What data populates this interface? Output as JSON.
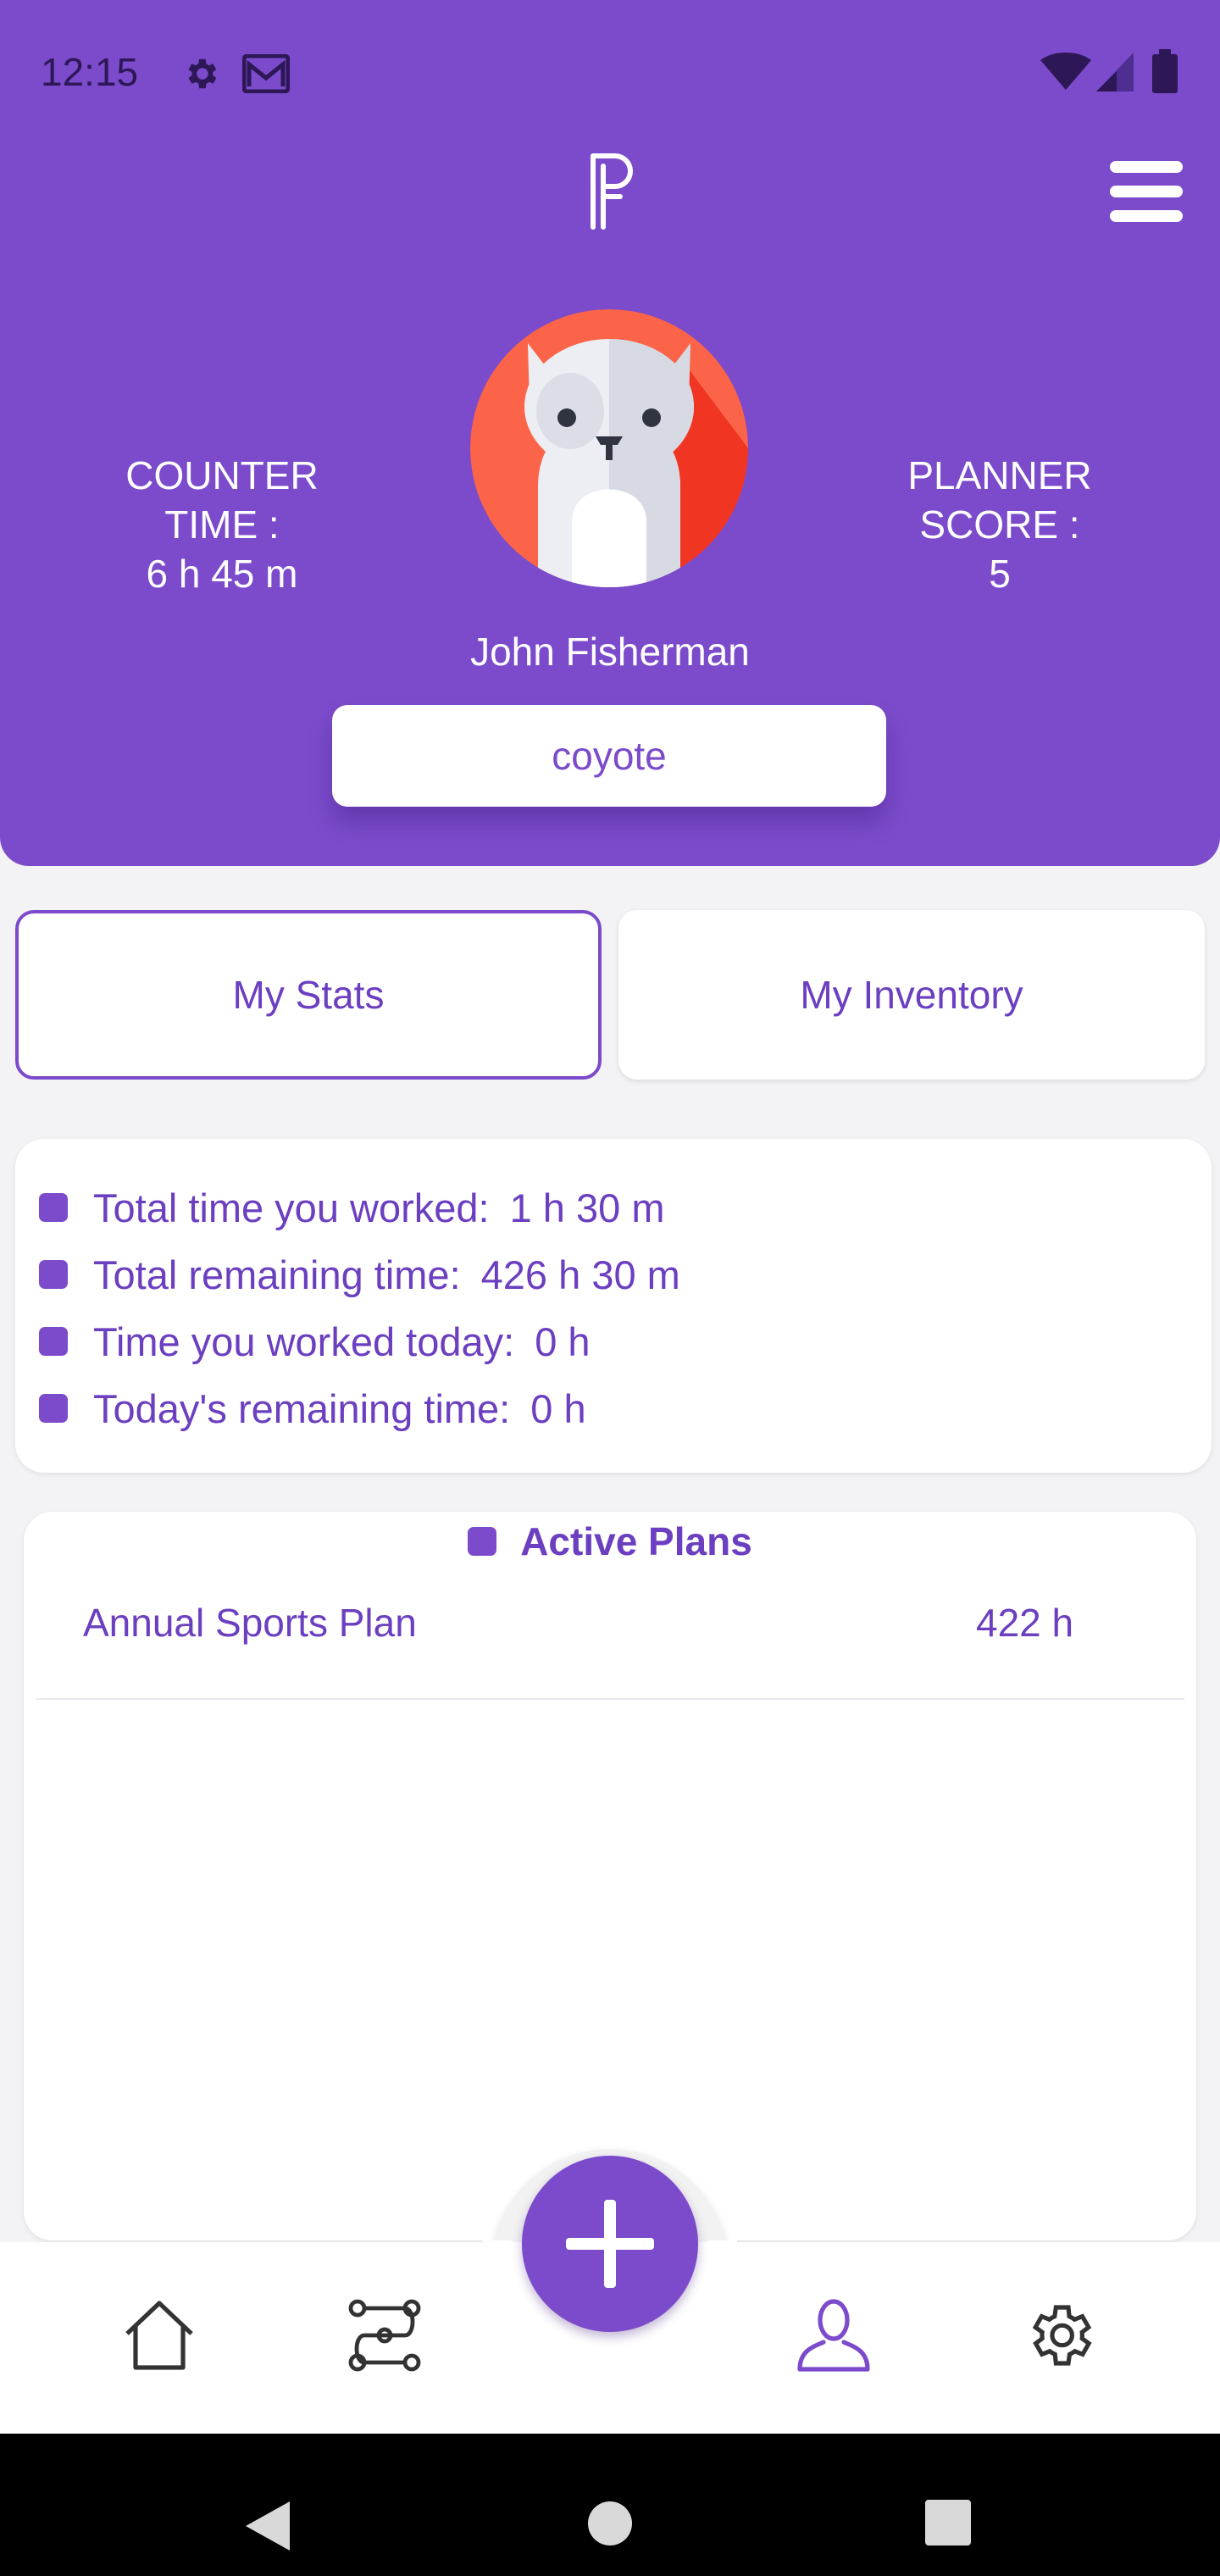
{
  "status_bar": {
    "time": "12:15",
    "left_icons": [
      "gear-icon",
      "gmail-icon"
    ],
    "right_icons": [
      "wifi-icon",
      "signal-icon",
      "battery-icon"
    ]
  },
  "header": {
    "logo": "planner-logo-icon",
    "menu_icon": "hamburger-menu-icon",
    "counter_time": {
      "line1": "COUNTER",
      "line2": "TIME :",
      "value": "6 h 45 m"
    },
    "planner_score": {
      "line1": "PLANNER",
      "line2": "SCORE :",
      "value": "5"
    },
    "avatar": "cat-avatar",
    "name": "John Fisherman",
    "username": "coyote"
  },
  "tabs": [
    {
      "label": "My Stats",
      "active": true
    },
    {
      "label": "My Inventory",
      "active": false
    }
  ],
  "stats": [
    {
      "label": "Total time you worked:",
      "value": "1 h 30 m"
    },
    {
      "label": "Total remaining time:",
      "value": "426 h 30 m"
    },
    {
      "label": "Time you worked today:",
      "value": "0 h"
    },
    {
      "label": "Today's remaining time:",
      "value": "0 h"
    }
  ],
  "active_plans": {
    "title": "Active Plans",
    "plans": [
      {
        "name": "Annual Sports Plan",
        "hours": "422 h"
      }
    ]
  },
  "bottom_nav": {
    "items": [
      "home-icon",
      "routes-icon",
      "add-icon",
      "profile-icon",
      "settings-icon"
    ],
    "active": "profile-icon"
  },
  "system_nav": [
    "back-icon",
    "home-circle-icon",
    "recents-icon"
  ],
  "colors": {
    "primary": "#7b4bcb",
    "text_accent": "#6b3fc0",
    "background": "#f3f2f4",
    "avatar_bg": "#fb6448"
  }
}
